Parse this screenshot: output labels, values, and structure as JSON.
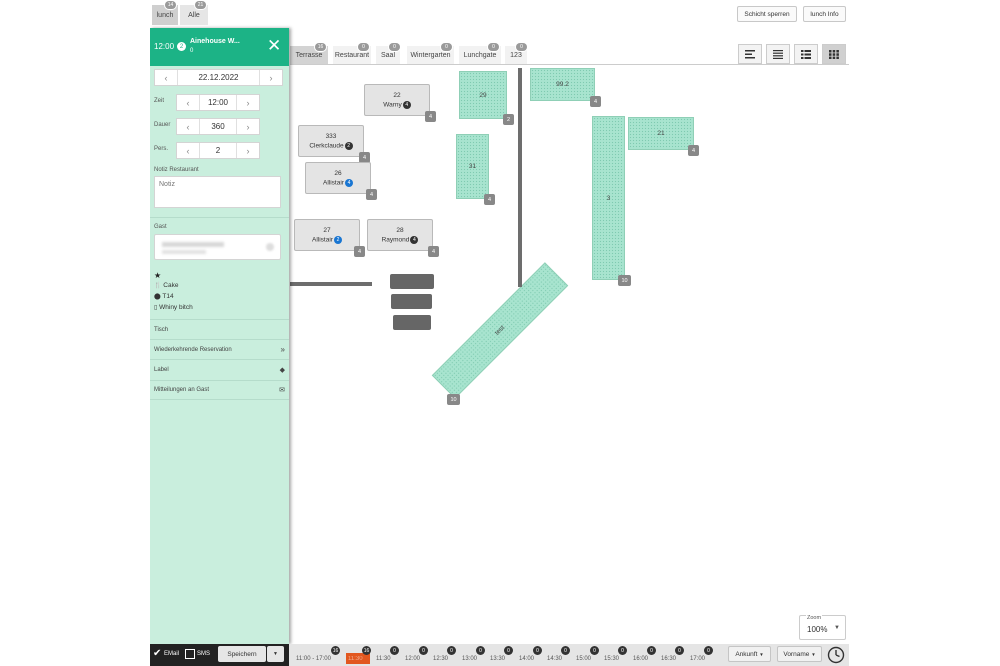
{
  "header": {
    "tabs": [
      {
        "label": "lunch",
        "count": "14"
      },
      {
        "label": "Alle",
        "count": "21"
      }
    ],
    "buttons": {
      "lock_shift": "Schicht sperren",
      "shift_info": "lunch Info"
    }
  },
  "rooms": [
    {
      "label": "Terrasse",
      "count": "16"
    },
    {
      "label": "Restaurant",
      "count": "0"
    },
    {
      "label": "Saal",
      "count": "0"
    },
    {
      "label": "Wintergarten",
      "count": "0"
    },
    {
      "label": "Lunchgate",
      "count": "0"
    },
    {
      "label": "123",
      "count": "0"
    }
  ],
  "tables": {
    "t22": {
      "num": "22",
      "guest": "Warny",
      "guests": "4",
      "cap": "4"
    },
    "t333": {
      "num": "333",
      "guest": "Clerkclaude",
      "guests": "2",
      "cap": "4"
    },
    "t26": {
      "num": "26",
      "guest": "Allistair",
      "guests": "4",
      "cap": "4"
    },
    "t27": {
      "num": "27",
      "guest": "Allistair",
      "guests": "2",
      "cap": "4"
    },
    "t28": {
      "num": "28",
      "guest": "Raymond",
      "guests": "4",
      "cap": "4"
    },
    "t29": {
      "num": "29",
      "cap": "2"
    },
    "t99": {
      "num": "99.2",
      "cap": "4"
    },
    "t31": {
      "num": "31",
      "cap": "4"
    },
    "t3": {
      "num": "3",
      "cap": "10"
    },
    "t21": {
      "num": "21",
      "cap": "4"
    },
    "ttest": {
      "num": "test",
      "cap": "10"
    }
  },
  "panel": {
    "time": "12:00",
    "guests_badge": "2",
    "title": "Ainehouse W...",
    "subtitle": "0",
    "date": "22.12.2022",
    "zeit_label": "Zeit",
    "zeit": "12:00",
    "dauer_label": "Dauer",
    "dauer": "360",
    "pers_label": "Pers.",
    "pers": "2",
    "notiz_label": "Notiz Restaurant",
    "notiz_placeholder": "Notiz",
    "gast_label": "Gast",
    "guest_info": {
      "food": "Cake",
      "location": "T14",
      "note": "Whiny bitch"
    },
    "rows": [
      "Tisch",
      "Wiederkehrende Reservation",
      "Label",
      "Mitteilungen an Gast"
    ]
  },
  "bottom": {
    "email": "EMail",
    "sms": "SMS",
    "save": "Speichern",
    "range": "11:00 - 17:00",
    "times": [
      {
        "t": "11:30",
        "c": "16"
      },
      {
        "t": "11:30",
        "c": "0"
      },
      {
        "t": "12:00",
        "c": "0"
      },
      {
        "t": "12:30",
        "c": "0"
      },
      {
        "t": "13:00",
        "c": "0"
      },
      {
        "t": "13:30",
        "c": "0"
      },
      {
        "t": "14:00",
        "c": "0"
      },
      {
        "t": "14:30",
        "c": "0"
      },
      {
        "t": "15:00",
        "c": "0"
      },
      {
        "t": "15:30",
        "c": "0"
      },
      {
        "t": "16:00",
        "c": "0"
      },
      {
        "t": "16:30",
        "c": "0"
      },
      {
        "t": "17:00",
        "c": "0"
      }
    ],
    "range_count": "16",
    "ankunft": "Ankunft",
    "vorname": "Vorname",
    "zoom_label": "Zoom",
    "zoom": "100%"
  },
  "colors": {
    "accent": "#1cb386",
    "panel_bg": "#c9eedd",
    "table_green": "#a8e4cf",
    "current_time": "#e2571f"
  }
}
